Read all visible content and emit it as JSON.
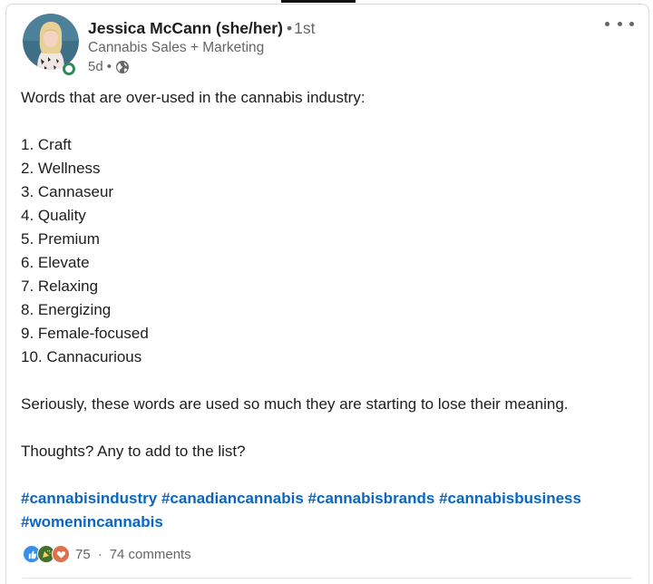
{
  "author": {
    "name": "Jessica McCann (she/her)",
    "degree": "1st",
    "headline": "Cannabis Sales + Marketing",
    "time_ago": "5d",
    "bullet": "•",
    "visibility_icon": "globe-icon",
    "presence_color": "#2e8b57"
  },
  "post": {
    "intro": "Words that are over-used in the cannabis industry:",
    "list": [
      "1. Craft",
      "2. Wellness",
      "3. Cannaseur",
      "4. Quality",
      "5. Premium",
      "6. Elevate",
      "7. Relaxing",
      "8. Energizing",
      "9. Female-focused",
      "10. Cannacurious"
    ],
    "paragraph_1": "Seriously, these words are used so much they are starting to lose their meaning.",
    "paragraph_2": "Thoughts? Any to add to the list?",
    "hashtags": [
      "#cannabisindustry",
      "#canadiancannabis",
      "#cannabisbrands",
      "#cannabisbusiness",
      "#womenincannabis"
    ]
  },
  "social": {
    "reaction_icons": [
      "like-icon",
      "celebrate-icon",
      "love-icon"
    ],
    "reaction_count": "75",
    "separator": "·",
    "comments": "74 comments"
  },
  "colors": {
    "link": "#0a66c2",
    "like": "#378fe9",
    "celebrate": "#44712e",
    "love": "#df704d",
    "muted": "#666666"
  }
}
